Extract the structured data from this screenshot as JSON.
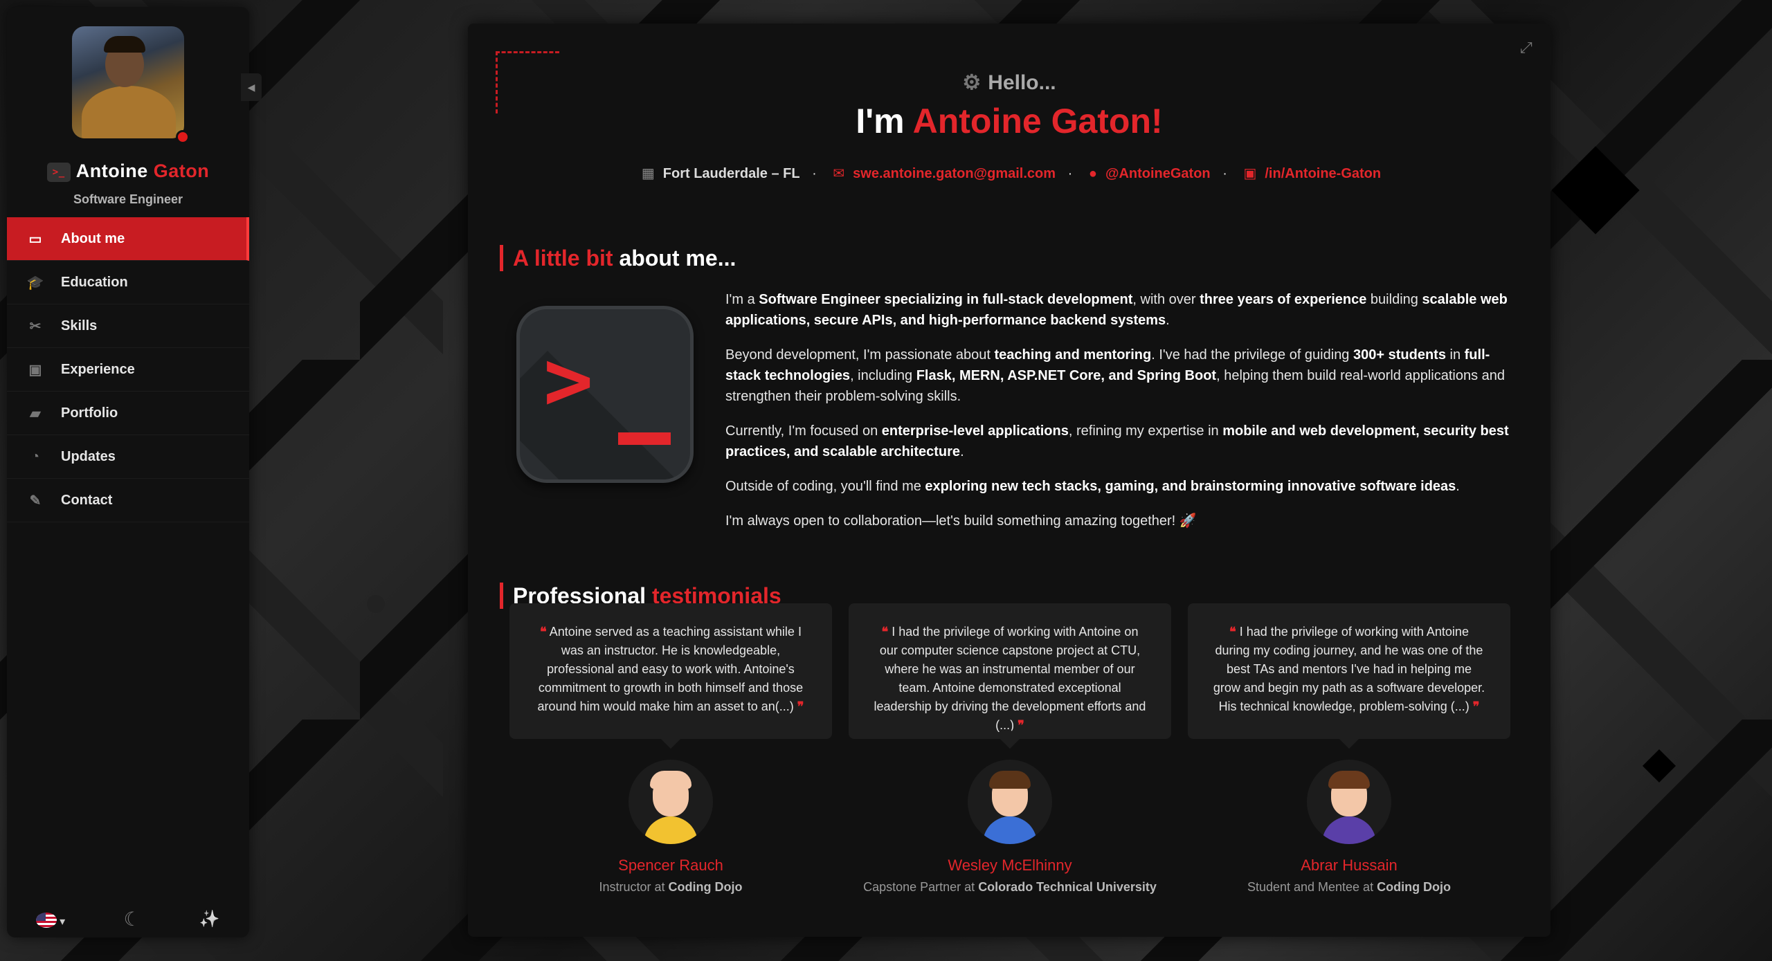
{
  "sidebar": {
    "name_first": "Antoine",
    "name_last": "Gaton",
    "role": "Software Engineer",
    "items": [
      {
        "label": "About me",
        "icon": "id-card-icon",
        "glyph": "▭"
      },
      {
        "label": "Education",
        "icon": "graduation-cap-icon",
        "glyph": "🎓"
      },
      {
        "label": "Skills",
        "icon": "tools-icon",
        "glyph": "✂"
      },
      {
        "label": "Experience",
        "icon": "briefcase-icon",
        "glyph": "▣"
      },
      {
        "label": "Portfolio",
        "icon": "folder-open-icon",
        "glyph": "▰"
      },
      {
        "label": "Updates",
        "icon": "rss-icon",
        "glyph": "◔"
      },
      {
        "label": "Contact",
        "icon": "edit-icon",
        "glyph": "✎"
      }
    ],
    "footer": {
      "language_caret": "▾",
      "moon": "☾",
      "wand": "✨"
    }
  },
  "header": {
    "hello": "Hello...",
    "title_prefix": "I'm ",
    "title_name": "Antoine Gaton!",
    "location": "Fort Lauderdale – FL",
    "email": "swe.antoine.gaton@gmail.com",
    "github": "@AntoineGaton",
    "linkedin": "/in/Antoine-Gaton",
    "sep": "·"
  },
  "about": {
    "heading_red": "A little bit",
    "heading_white": " about me...",
    "p1": [
      {
        "t": "I'm a ",
        "b": false
      },
      {
        "t": "Software Engineer specializing in full-stack development",
        "b": true
      },
      {
        "t": ", with over ",
        "b": false
      },
      {
        "t": "three years of experience",
        "b": true
      },
      {
        "t": " building ",
        "b": false
      },
      {
        "t": "scalable web applications, secure APIs, and high-performance backend systems",
        "b": true
      },
      {
        "t": ".",
        "b": false
      }
    ],
    "p2": [
      {
        "t": "Beyond development, I'm passionate about ",
        "b": false
      },
      {
        "t": "teaching and mentoring",
        "b": true
      },
      {
        "t": ". I've had the privilege of guiding ",
        "b": false
      },
      {
        "t": "300+ students",
        "b": true
      },
      {
        "t": " in ",
        "b": false
      },
      {
        "t": "full-stack technologies",
        "b": true
      },
      {
        "t": ", including ",
        "b": false
      },
      {
        "t": "Flask, MERN, ASP.NET Core, and Spring Boot",
        "b": true
      },
      {
        "t": ", helping them build real-world applications and strengthen their problem-solving skills.",
        "b": false
      }
    ],
    "p3": [
      {
        "t": "Currently, I'm focused on ",
        "b": false
      },
      {
        "t": "enterprise-level applications",
        "b": true
      },
      {
        "t": ", refining my expertise in ",
        "b": false
      },
      {
        "t": "mobile and web development, security best practices, and scalable architecture",
        "b": true
      },
      {
        "t": ".",
        "b": false
      }
    ],
    "p4": [
      {
        "t": "Outside of coding, you'll find me ",
        "b": false
      },
      {
        "t": "exploring new tech stacks, gaming, and brainstorming innovative software ideas",
        "b": true
      },
      {
        "t": ".",
        "b": false
      }
    ],
    "p5": [
      {
        "t": "I'm always open to collaboration—let's build something amazing together! 🚀",
        "b": false
      }
    ]
  },
  "testimonials": {
    "heading_white": "Professional ",
    "heading_red": "testimonials",
    "items": [
      {
        "quote": "Antoine served as a teaching assistant while I was an instructor. He is knowledgeable, professional and easy to work with. Antoine's commitment to growth in both himself and those around him would make him an asset to an(...)",
        "name": "Spencer Rauch",
        "role_prefix": "Instructor at ",
        "org": "Coding Dojo",
        "shirt": "#f2c230",
        "hair": "#f3c7a8"
      },
      {
        "quote": "I had the privilege of working with Antoine on our computer science capstone project at CTU, where he was an instrumental member of our team. Antoine demonstrated exceptional leadership by driving the development efforts and (...)",
        "name": "Wesley McElhinny",
        "role_prefix": "Capstone Partner at ",
        "org": "Colorado Technical University",
        "shirt": "#3b6fd6",
        "hair": "#5a3418"
      },
      {
        "quote": "I had the privilege of working with Antoine during my coding journey, and he was one of the best TAs and mentors I've had in helping me grow and begin my path as a software developer. His technical knowledge, problem-solving (...)",
        "name": "Abrar Hussain",
        "role_prefix": "Student and Mentee at ",
        "org": "Coding Dojo",
        "shirt": "#5a3fa8",
        "hair": "#6a3a1c"
      }
    ],
    "open_quote": "❝",
    "close_quote": "❞"
  },
  "colors": {
    "accent": "#e3262b",
    "panel": "#111111",
    "card": "#1e1e1e"
  }
}
